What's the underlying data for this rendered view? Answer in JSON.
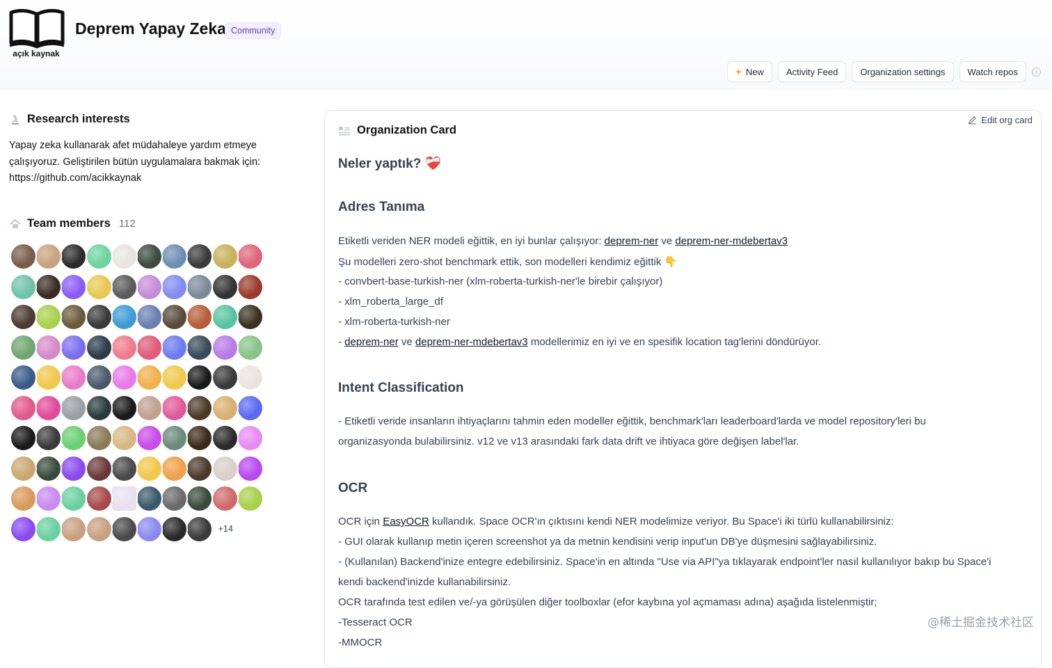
{
  "org": {
    "logo_caption": "açık kaynak",
    "name": "Deprem Yapay Zeka",
    "badge": "Community"
  },
  "toolbar": {
    "new_label": "New",
    "activity_label": "Activity Feed",
    "settings_label": "Organization settings",
    "watch_label": "Watch repos"
  },
  "research": {
    "title": "Research interests",
    "text_line1": "Yapay zeka kullanarak afet müdahaleye yardım etmeye",
    "text_line2": "çalışıyoruz. Geliştirilen bütün uygulamalara bakmak için:",
    "text_line3": "https://github.com/acikkaynak"
  },
  "team": {
    "title": "Team members",
    "count": "112",
    "more": "+14",
    "avatar_colors": [
      "#7a5c4a",
      "#c9a27e",
      "#2b2b2b",
      "#6ed3a0",
      "#e9e4df",
      "#3d4a3f",
      "#6b8fb3",
      "#3a3a3a",
      "#c8b15a",
      "#e0647a",
      "#6ec3a8",
      "#3b2b24",
      "#8a5cf6",
      "#e8c850",
      "#5b5b5b",
      "#c58bd8",
      "#7f8cf0",
      "#7b8a9a",
      "#333333",
      "#9b3b2e",
      "#4a3a30",
      "#a8d04a",
      "#6a5a3a",
      "#3a3a3a",
      "#3c9bd6",
      "#6a7fb0",
      "#5a4a3a",
      "#b85c3a",
      "#57c4a0",
      "#3a3020",
      "#6fa66f",
      "#d48ac8",
      "#7c6cf0",
      "#2c3a4a",
      "#f07a8a",
      "#e05a7a",
      "#6a7cf0",
      "#3a4a5a",
      "#b87ae8",
      "#88c488",
      "#3a5a8a",
      "#f0c84a",
      "#e87ac8",
      "#4a5a6a",
      "#e87ae8",
      "#f0b04a",
      "#f0c84a",
      "#1a1a1a",
      "#3a3a3a",
      "#e8e4e0",
      "#e05a8a",
      "#e04a9a",
      "#9aa0a6",
      "#2a3a3a",
      "#1a1a1a",
      "#c0a090",
      "#e05a9a",
      "#4a3a2a",
      "#d8b070",
      "#5a6af0",
      "#1a1a1a",
      "#3a3a3a",
      "#6ad070",
      "#8a7a5a",
      "#d8b880",
      "#c84ae8",
      "#6a8a7a",
      "#3a2a1a",
      "#2a2a2a",
      "#e88af0",
      "#c8a870",
      "#3a4a3a",
      "#8a4af0",
      "#6a3a3a",
      "#4a4a4a",
      "#f0c84a",
      "#f0a04a",
      "#4a3a2a",
      "#d8d0c8",
      "#b84af0",
      "#d89a5a",
      "#c88af0",
      "#6ad0a0",
      "#a84a4a",
      "#e8e0f0",
      "#3a5a6a",
      "#6a6a6a",
      "#3a4a3a",
      "#d06a6a",
      "#a8d04a",
      "#8a4af0",
      "#6ad0a0",
      "#c8a080",
      "#c8a080",
      "#4a4a4a",
      "#8a8af0",
      "#2a2a2a",
      "#3a3a3a"
    ]
  },
  "card": {
    "title": "Organization Card",
    "edit_label": "Edit org card",
    "heading_main": "Neler yaptık?",
    "heart_emoji": "❤️‍🩹",
    "s1_title": "Adres Tanıma",
    "s1_l1_prefix": "Etiketli veriden NER modeli eğittik, en iyi bunlar çalışıyor: ",
    "s1_l1_link1": "deprem-ner",
    "s1_l1_mid": " ve ",
    "s1_l1_link2": "deprem-ner-mdebertav3",
    "s1_l2": "Şu modelleri zero-shot benchmark ettik, son modelleri kendimiz eğittik",
    "s1_l2_emoji": "👇",
    "s1_l3": "- convbert-base-turkish-ner (xlm-roberta-turkish-ner'le birebir çalışıyor)",
    "s1_l4": "- xlm_roberta_large_df",
    "s1_l5": "- xlm-roberta-turkish-ner",
    "s1_l6_prefix": "- ",
    "s1_l6_link1": "deprem-ner",
    "s1_l6_mid": " ve ",
    "s1_l6_link2": "deprem-ner-mdebertav3",
    "s1_l6_suffix": " modellerimiz en iyi ve en spesifik location tag'lerini döndürüyor.",
    "s2_title": "Intent Classification",
    "s2_l1": "- Etiketli veride insanların ihtiyaçlarını tahmin eden modeller eğittik, benchmark'ları leaderboard'larda ve model repository'leri bu",
    "s2_l2": "organizasyonda bulabilirsiniz. v12 ve v13 arasındaki fark data drift ve ihtiyaca göre değişen label'lar.",
    "s3_title": "OCR",
    "s3_l1_prefix": "OCR için ",
    "s3_l1_link": "EasyOCR",
    "s3_l1_suffix": " kullandık. Space OCR'ın çıktısını kendi NER modelimize veriyor. Bu Space'i iki türlü kullanabilirsiniz:",
    "s3_l2": "- GUI olarak kullanıp metin içeren screenshot ya da metnin kendisini verip input'un DB'ye düşmesini sağlayabilirsiniz.",
    "s3_l3": "- (Kullanılan) Backend'inize entegre edebilirsiniz. Space'in en altında \"Use via API\"ya tıklayarak endpoint'ler nasıl kullanılıyor bakıp bu Space'i",
    "s3_l4": "kendi backend'inizde kullanabilirsiniz.",
    "s3_l5": "OCR tarafında test edilen ve/-ya görüşülen diğer toolboxlar (efor kaybına yol açmaması adına) aşağıda listelenmiştir;",
    "s3_l6": "-Tesseract OCR",
    "s3_l7": "-MMOCR"
  },
  "watermark": "@稀土掘金技术社区"
}
